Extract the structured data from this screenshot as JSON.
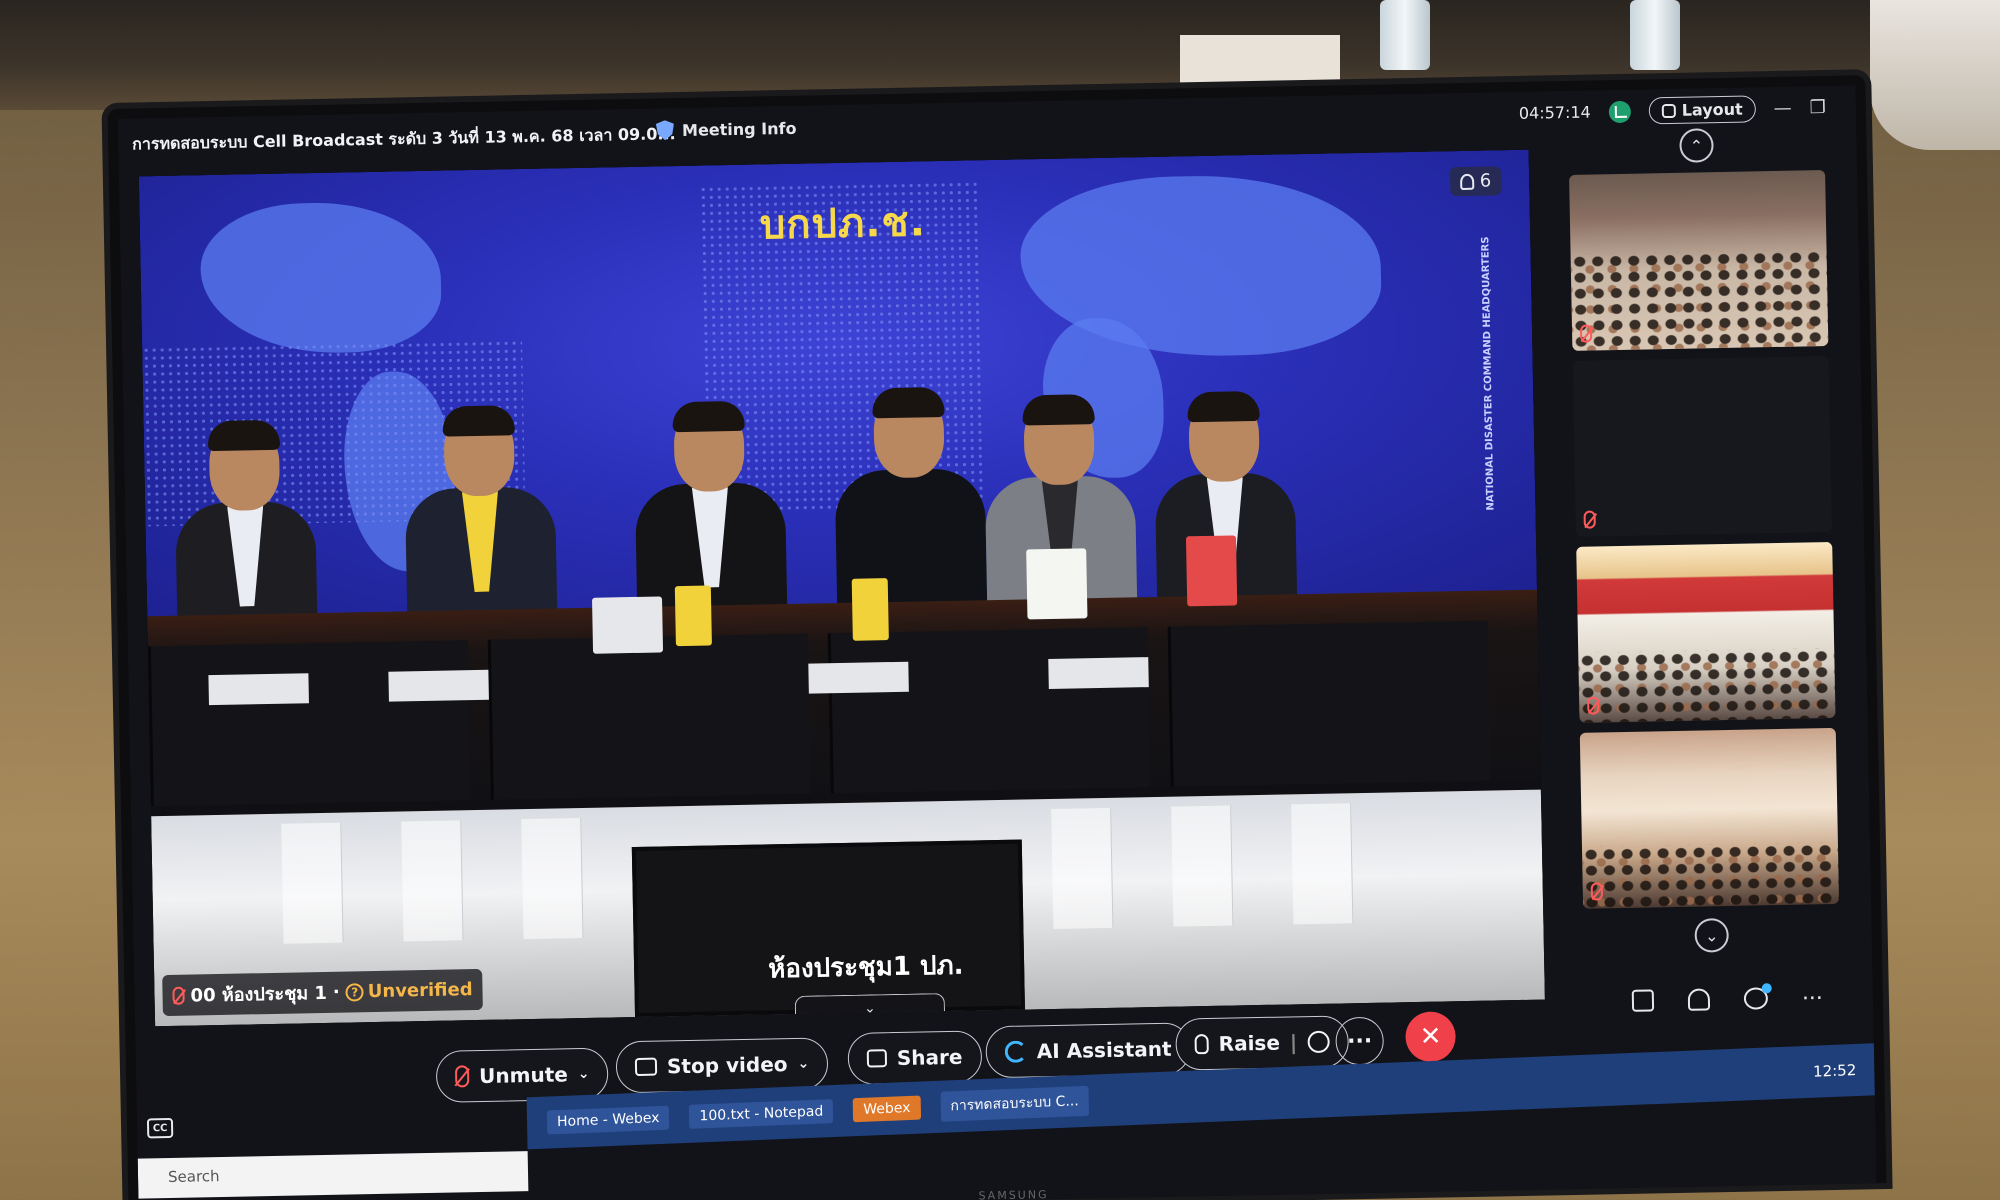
{
  "window": {
    "title": "การทดสอบระบบ Cell Broadcast ระดับ 3 วันที่ 13 พ.ค. 68 เวลา 09.0...",
    "meeting_info_label": "Meeting Info",
    "timer": "04:57:14",
    "layout_label": "Layout"
  },
  "main_video": {
    "backdrop_logo": "บกปภ.ช.",
    "side_text": "NATIONAL DISASTER COMMAND HEADQUARTERS",
    "participant_count": "6",
    "inner_room_label": "ห้องประชุม1 ปภ.",
    "name_tag": "00 ห้องประชุม 1",
    "unverified_label": "Unverified"
  },
  "thumbnails": [
    {
      "type": "conference-room",
      "muted": true
    },
    {
      "type": "video-off",
      "muted": true
    },
    {
      "type": "meeting-hall-red",
      "muted": true
    },
    {
      "type": "meeting-room",
      "muted": true
    }
  ],
  "controls": {
    "unmute_label": "Unmute",
    "stop_video_label": "Stop video",
    "share_label": "Share",
    "ai_assistant_label": "AI Assistant",
    "raise_label": "Raise",
    "more_label": "···",
    "end_label": "✕"
  },
  "taskbar": {
    "search_placeholder": "Search",
    "items": [
      "Home - Webex",
      "100.txt - Notepad",
      "Webex",
      "การทดสอบระบบ C..."
    ],
    "clock": "12:52",
    "monitor_brand": "SAMSUNG"
  },
  "colors": {
    "backdrop_blue": "#2a2fb8",
    "logo_yellow": "#f6d84a",
    "end_red": "#f0414a",
    "ai_blue": "#3fb6ff",
    "unverified_orange": "#f5b64a"
  }
}
